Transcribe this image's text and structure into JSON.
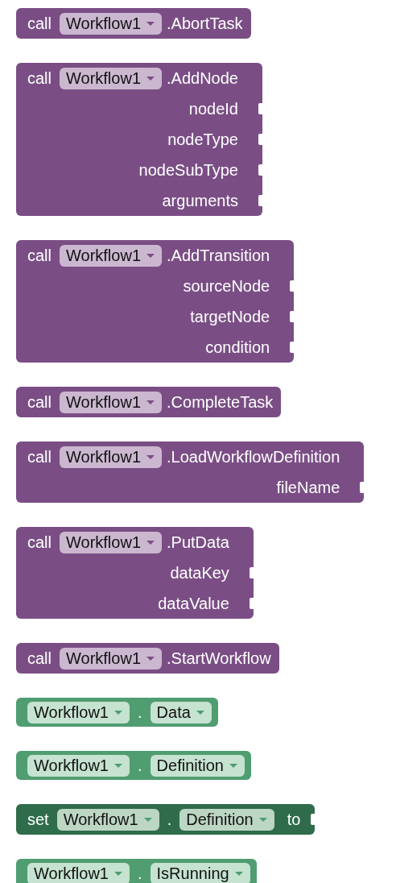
{
  "blocks": [
    {
      "kind": "call",
      "keyword": "call",
      "component": "Workflow1",
      "method": ".AbortTask"
    },
    {
      "kind": "call",
      "keyword": "call",
      "component": "Workflow1",
      "method": ".AddNode",
      "params": [
        "nodeId",
        "nodeType",
        "nodeSubType",
        "arguments"
      ]
    },
    {
      "kind": "call",
      "keyword": "call",
      "component": "Workflow1",
      "method": ".AddTransition",
      "params": [
        "sourceNode",
        "targetNode",
        "condition"
      ]
    },
    {
      "kind": "call",
      "keyword": "call",
      "component": "Workflow1",
      "method": ".CompleteTask"
    },
    {
      "kind": "call",
      "keyword": "call",
      "component": "Workflow1",
      "method": ".LoadWorkflowDefinition",
      "params": [
        "fileName"
      ]
    },
    {
      "kind": "call",
      "keyword": "call",
      "component": "Workflow1",
      "method": ".PutData",
      "params": [
        "dataKey",
        "dataValue"
      ]
    },
    {
      "kind": "call",
      "keyword": "call",
      "component": "Workflow1",
      "method": ".StartWorkflow"
    },
    {
      "kind": "getter",
      "component": "Workflow1",
      "dot": ".",
      "property": "Data"
    },
    {
      "kind": "getter",
      "component": "Workflow1",
      "dot": ".",
      "property": "Definition"
    },
    {
      "kind": "setter",
      "keyword": "set",
      "component": "Workflow1",
      "dot": ".",
      "property": "Definition",
      "suffix": "to"
    },
    {
      "kind": "getter",
      "component": "Workflow1",
      "dot": ".",
      "property": "IsRunning"
    }
  ]
}
